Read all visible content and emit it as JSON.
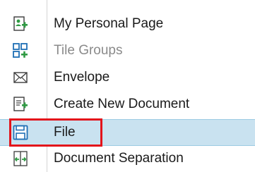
{
  "menu": {
    "items": [
      {
        "label": "My Personal Page",
        "icon": "personal-page-icon",
        "enabled": true,
        "selected": false
      },
      {
        "label": "Tile Groups",
        "icon": "tile-groups-icon",
        "enabled": false,
        "selected": false
      },
      {
        "label": "Envelope",
        "icon": "envelope-icon",
        "enabled": true,
        "selected": false
      },
      {
        "label": "Create New Document",
        "icon": "create-document-icon",
        "enabled": true,
        "selected": false
      },
      {
        "label": "File",
        "icon": "save-file-icon",
        "enabled": true,
        "selected": true
      },
      {
        "label": "Document Separation",
        "icon": "document-separation-icon",
        "enabled": true,
        "selected": false
      }
    ]
  },
  "colors": {
    "accent_green": "#2f9a43",
    "selection": "#c9e2f0",
    "highlight": "#e3141b",
    "disabled_text": "#8a8a8a"
  }
}
